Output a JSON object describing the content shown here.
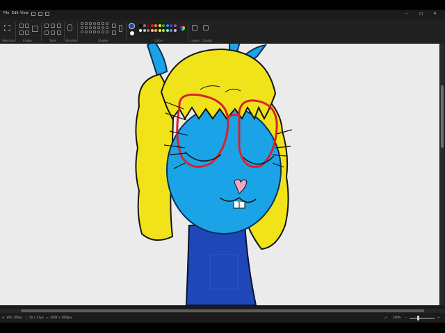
{
  "menu": {
    "items": [
      "File",
      "Edit",
      "View"
    ]
  },
  "ribbon": {
    "groups": [
      "Selection",
      "Image",
      "Tools",
      "Brushes",
      "Shapes",
      "Colors",
      "Layers",
      "Copilot"
    ]
  },
  "palette": {
    "selected_color": "#1f47b8",
    "colors": [
      "#000000",
      "#7f7f7f",
      "#880015",
      "#ed1c24",
      "#ff7f27",
      "#fff200",
      "#22b14c",
      "#00a2e8",
      "#3f48cc",
      "#a349a4",
      "#ffffff",
      "#c3c3c3",
      "#b97a57",
      "#ffaec9",
      "#ffc90e",
      "#efe4b0",
      "#b5e61d",
      "#99d9ea",
      "#7092be",
      "#c8bfe7"
    ]
  },
  "status": {
    "cursor_pos": "100, 100px",
    "selection_size": "50 × 51px",
    "canvas_size": "1000 × 1000px",
    "zoom": "100%"
  }
}
